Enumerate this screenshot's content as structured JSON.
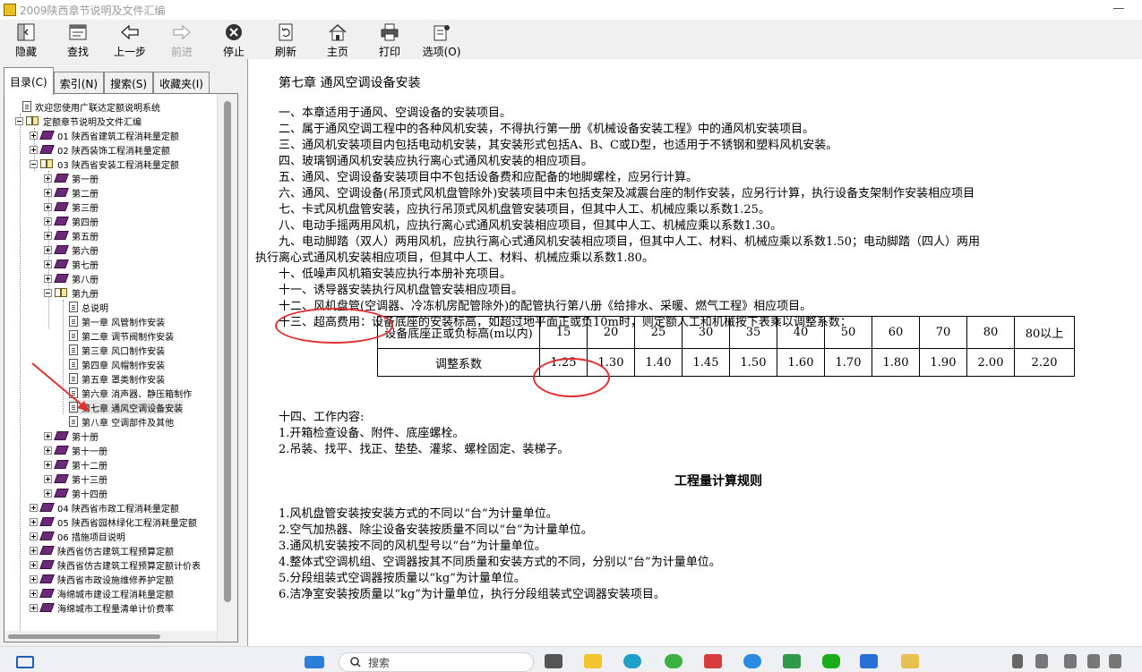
{
  "window": {
    "title": "2009陕西章节说明及文件汇编"
  },
  "toolbar": {
    "hide": "隐藏",
    "find": "查找",
    "back": "上一步",
    "forward": "前进",
    "stop": "停止",
    "refresh": "刷新",
    "home": "主页",
    "print": "打印",
    "options": "选项(O)"
  },
  "tabs": {
    "contents": "目录(C)",
    "index": "索引(N)",
    "search": "搜索(S)",
    "favorites": "收藏夹(I)"
  },
  "tree": {
    "items": [
      "欢迎您使用广联达定额说明系统",
      "定额章节说明及文件汇编",
      "01 陕西省建筑工程消耗量定额",
      "02 陕西装饰工程消耗量定额",
      "03 陕西省安装工程消耗量定额",
      "第一册",
      "第二册",
      "第三册",
      "第四册",
      "第五册",
      "第六册",
      "第七册",
      "第八册",
      "第九册",
      "总说明",
      "第一章  风管制作安装",
      "第二章  调节阀制作安装",
      "第三章  风口制作安装",
      "第四章  风帽制作安装",
      "第五章  罩类制作安装",
      "第六章  消声器、静压箱制作",
      "第七章  通风空调设备安装",
      "第八章  空调部件及其他",
      "第十册",
      "第十一册",
      "第十二册",
      "第十三册",
      "第十四册",
      "04 陕西省市政工程消耗量定额",
      "05 陕西省园林绿化工程消耗量定额",
      "06 措施项目说明",
      "陕西省仿古建筑工程预算定额",
      "陕西省仿古建筑工程预算定额计价表",
      "陕西省市政设施维修养护定额",
      "海绵城市建设工程消耗量定额",
      "海绵城市工程量清单计价费率"
    ]
  },
  "content": {
    "chapter_title": "第七章 通风空调设备安装",
    "lines": [
      "一、本章适用于通风、空调设备的安装项目。",
      "二、属于通风空调工程中的各种风机安装，不得执行第一册《机械设备安装工程》中的通风机安装项目。",
      "三、通风机安装项目内包括电动机安装，其安装形式包括A、B、C或D型，也适用于不锈钢和塑料风机安装。",
      "四、玻璃钢通风机安装应执行离心式通风机安装的相应项目。",
      "五、通风、空调设备安装项目中不包括设备费和应配备的地脚螺栓，应另行计算。",
      "六、通风、空调设备(吊顶式风机盘管除外)安装项目中未包括支架及减震台座的制作安装，应另行计算，执行设备支架制作安装相应项目",
      "七、卡式风机盘管安装，应执行吊顶式风机盘管安装项目，但其中人工、机械应乘以系数1.25。",
      "八、电动手摇两用风机，应执行离心式通风机安装相应项目，但其中人工、机械应乘以系数1.30。",
      "九、电动脚踏（双人）两用风机，应执行离心式通风机安装相应项目，但其中人工、材料、机械应乘以系数1.50；电动脚踏（四人）两用",
      "执行离心式通风机安装相应项目，但其中人工、材料、机械应乘以系数1.80。",
      "十、低噪声风机箱安装应执行本册补充项目。",
      "十一、诱导器安装执行风机盘管安装相应项目。",
      "十二、风机盘管(空调器、冷冻机房配管除外)的配管执行第八册《给排水、采暖、燃气工程》相应项目。",
      "十三、超高费用：设备底座的安装标高，如超过地平面正或负10m时，则定额人工和机械按下表乘以调整系数："
    ],
    "table": {
      "header_label": "设备底座正或负标高(m以内)",
      "heights": [
        "15",
        "20",
        "25",
        "30",
        "35",
        "40",
        "50",
        "60",
        "70",
        "80",
        "80以上"
      ],
      "factor_label": "调整系数",
      "factors": [
        "1.25",
        "1.30",
        "1.40",
        "1.45",
        "1.50",
        "1.60",
        "1.70",
        "1.80",
        "1.90",
        "2.00",
        "2.20"
      ]
    },
    "section14": [
      "十四、工作内容:",
      "1.开箱检查设备、附件、底座螺栓。",
      "2.吊装、找平、找正、垫垫、灌浆、螺栓固定、装梯子。"
    ],
    "rules_heading": "工程量计算规则",
    "rules": [
      "1.风机盘管安装按安装方式的不同以“台”为计量单位。",
      "2.空气加热器、除尘设备安装按质量不同以“台”为计量单位。",
      "3.通风机安装按不同的风机型号以“台”为计量单位。",
      "4.整体式空调机组、空调器按其不同质量和安装方式的不同，分别以“台”为计量单位。",
      "5.分段组装式空调器按质量以“kg”为计量单位。",
      "6.洁净室安装按质量以“kg”为计量单位，执行分段组装式空调器安装项目。"
    ]
  },
  "taskbar": {
    "search_placeholder": "搜索"
  },
  "colors": {
    "annotation_red": "#e03030",
    "book_purple": "#6a2a78"
  }
}
